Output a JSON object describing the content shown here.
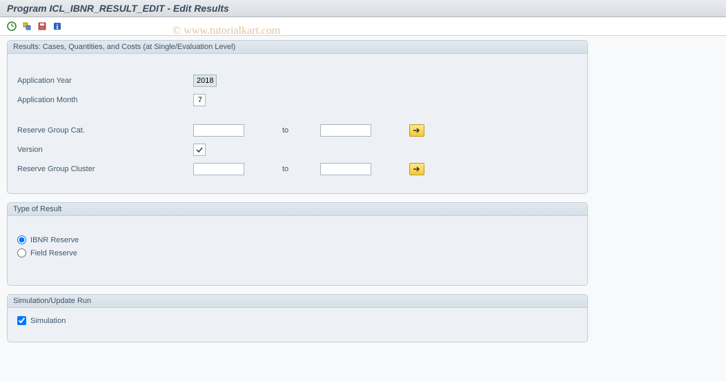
{
  "title": "Program ICL_IBNR_RESULT_EDIT - Edit Results",
  "watermark": "© www.tutorialkart.com",
  "group1": {
    "header": "Results: Cases, Quantities, and Costs (at Single/Evaluation Level)",
    "app_year_label": "Application Year",
    "app_year_value": "2018",
    "app_month_label": "Application Month",
    "app_month_value": "7",
    "reserve_cat_label": "Reserve Group Cat.",
    "reserve_cat_from": "",
    "reserve_cat_to": "",
    "to_label": "to",
    "version_label": "Version",
    "version_checked": true,
    "cluster_label": "Reserve Group Cluster",
    "cluster_from": "",
    "cluster_to": ""
  },
  "group2": {
    "header": "Type of Result",
    "radio_ibnr": "IBNR Reserve",
    "radio_field": "Field Reserve",
    "selected": "ibnr"
  },
  "group3": {
    "header": "Simulation/Update Run",
    "check_sim": "Simulation",
    "sim_checked": true
  },
  "icons": {
    "execute": "execute-icon",
    "variants": "variants-icon",
    "save": "save-icon",
    "info": "info-icon",
    "select_arrow": "arrow-right-icon"
  }
}
